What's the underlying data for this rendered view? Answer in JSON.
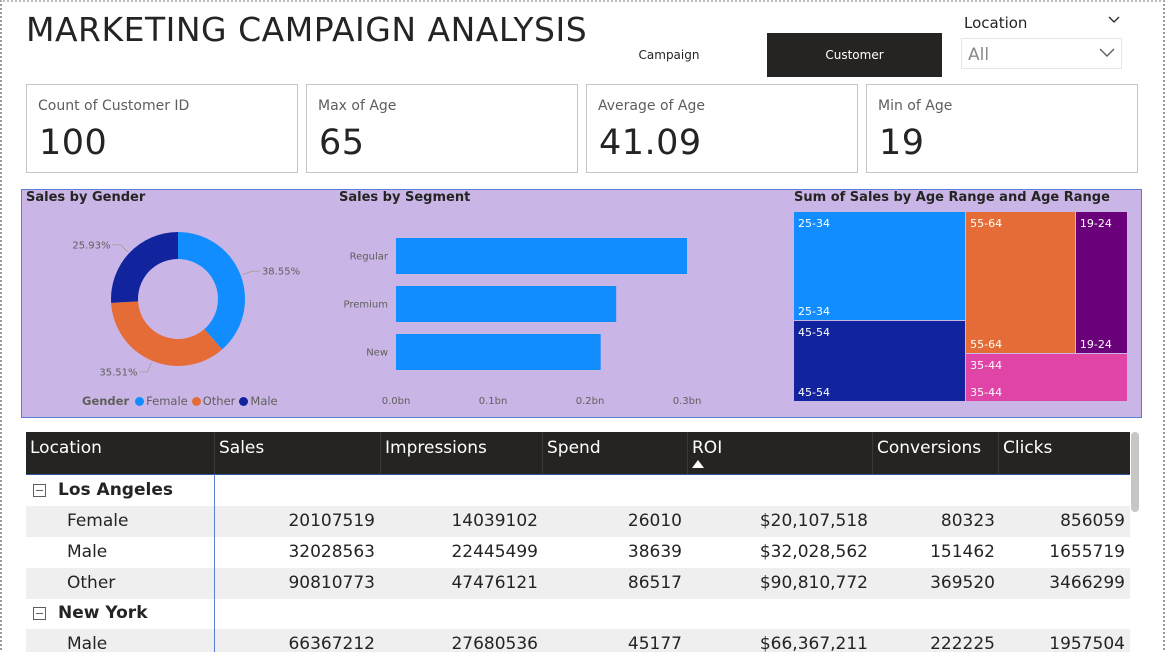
{
  "header": {
    "title": "MARKETING CAMPAIGN ANALYSIS",
    "tabs": [
      {
        "label": "Campaign",
        "active": false
      },
      {
        "label": "Customer",
        "active": true
      }
    ]
  },
  "filter": {
    "label": "Location",
    "value": "All"
  },
  "kpis": [
    {
      "label": "Count of Customer ID",
      "value": "100"
    },
    {
      "label": "Max of Age",
      "value": "65"
    },
    {
      "label": "Average of Age",
      "value": "41.09"
    },
    {
      "label": "Min of Age",
      "value": "19"
    }
  ],
  "charts": {
    "gender": {
      "title": "Sales by Gender",
      "legend_title": "Gender",
      "legend": [
        {
          "name": "Female",
          "color": "#118dff"
        },
        {
          "name": "Other",
          "color": "#e66c37"
        },
        {
          "name": "Male",
          "color": "#12239e"
        }
      ],
      "labels": [
        "38.55%",
        "35.51%",
        "25.93%"
      ]
    },
    "segment": {
      "title": "Sales by Segment",
      "ticks": [
        "0.0bn",
        "0.1bn",
        "0.2bn",
        "0.3bn"
      ],
      "categories": [
        "Regular",
        "Premium",
        "New"
      ]
    },
    "age": {
      "title": "Sum of Sales by Age Range and Age Range",
      "tiles": [
        {
          "name": "25-34",
          "color": "#118dff"
        },
        {
          "name": "55-64",
          "color": "#e66c37"
        },
        {
          "name": "19-24",
          "color": "#6b007b"
        },
        {
          "name": "45-54",
          "color": "#12239e"
        },
        {
          "name": "35-44",
          "color": "#e044a7"
        }
      ]
    }
  },
  "chart_data": [
    {
      "type": "pie",
      "title": "Sales by Gender",
      "categories": [
        "Female",
        "Other",
        "Male"
      ],
      "values": [
        38.55,
        35.51,
        25.93
      ],
      "colors": [
        "#118dff",
        "#e66c37",
        "#12239e"
      ],
      "legend_title": "Gender",
      "legend_position": "bottom"
    },
    {
      "type": "bar",
      "title": "Sales by Segment",
      "orientation": "horizontal",
      "categories": [
        "Regular",
        "Premium",
        "New"
      ],
      "values": [
        0.302,
        0.227,
        0.211
      ],
      "xlim": [
        0,
        0.3
      ],
      "ticks": [
        "0.0bn",
        "0.1bn",
        "0.2bn",
        "0.3bn"
      ],
      "color": "#118dff"
    },
    {
      "type": "treemap",
      "title": "Sum of Sales by Age Range and Age Range",
      "categories": [
        "25-34",
        "45-54",
        "55-64",
        "35-44",
        "19-24"
      ],
      "values": [
        0.24,
        0.18,
        0.2,
        0.1,
        0.095
      ],
      "colors": [
        "#118dff",
        "#12239e",
        "#e66c37",
        "#e044a7",
        "#6b007b"
      ]
    }
  ],
  "table": {
    "columns": [
      "Location",
      "Sales",
      "Impressions",
      "Spend",
      "ROI",
      "Conversions",
      "Clicks"
    ],
    "groups": [
      {
        "name": "Los Angeles",
        "rows": [
          {
            "label": "Female",
            "sales": "20107519",
            "impressions": "14039102",
            "spend": "26010",
            "roi": "$20,107,518",
            "conversions": "80323",
            "clicks": "856059"
          },
          {
            "label": "Male",
            "sales": "32028563",
            "impressions": "22445499",
            "spend": "38639",
            "roi": "$32,028,562",
            "conversions": "151462",
            "clicks": "1655719"
          },
          {
            "label": "Other",
            "sales": "90810773",
            "impressions": "47476121",
            "spend": "86517",
            "roi": "$90,810,772",
            "conversions": "369520",
            "clicks": "3466299"
          }
        ]
      },
      {
        "name": "New York",
        "rows": [
          {
            "label": "Male",
            "sales": "66367212",
            "impressions": "27680536",
            "spend": "45177",
            "roi": "$66,367,211",
            "conversions": "222225",
            "clicks": "1957504"
          }
        ]
      }
    ]
  }
}
